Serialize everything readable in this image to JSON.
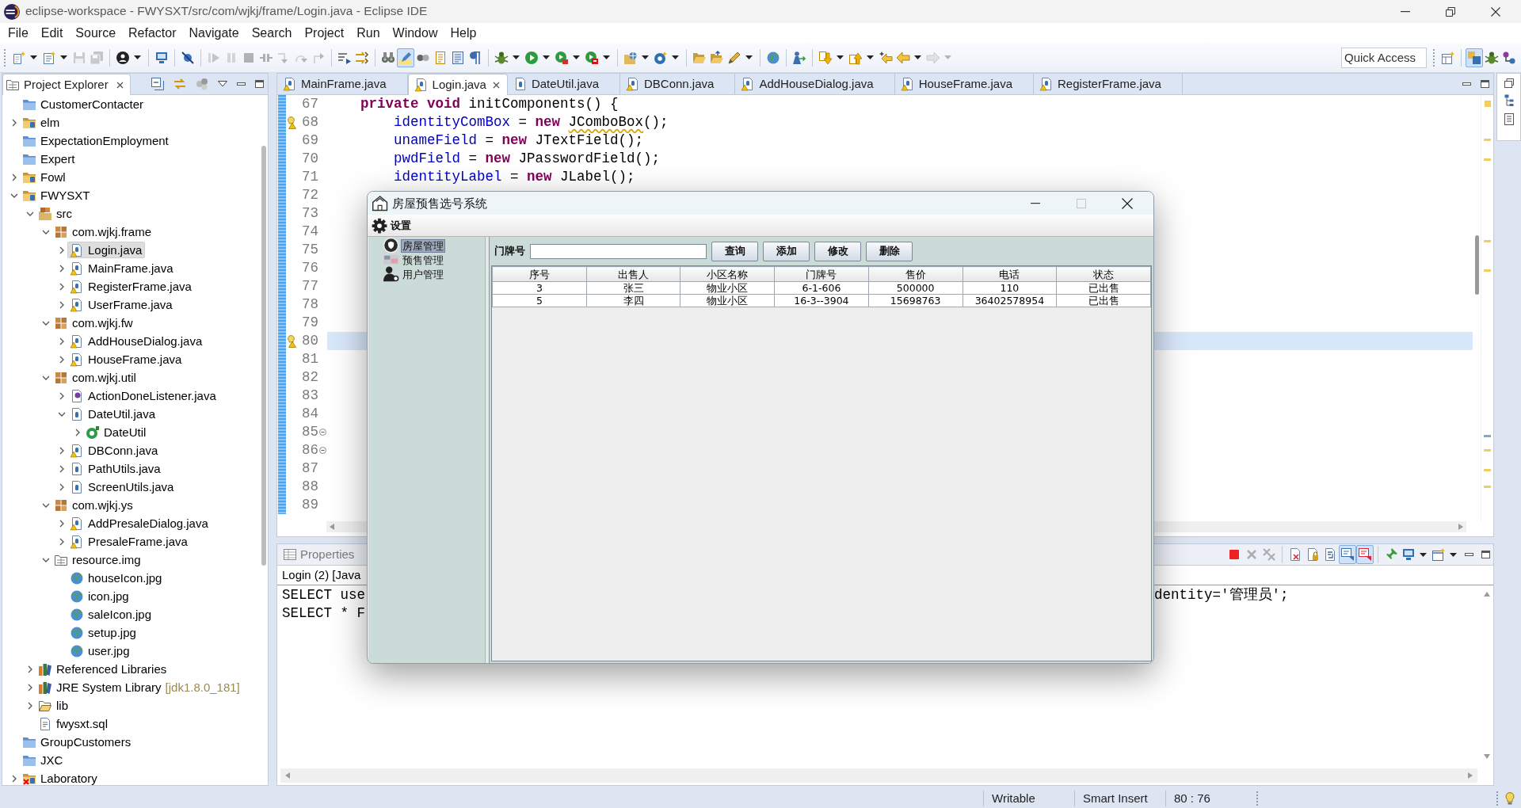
{
  "window": {
    "title": "eclipse-workspace - FWYSXT/src/com/wjkj/frame/Login.java - Eclipse IDE"
  },
  "menu": [
    "File",
    "Edit",
    "Source",
    "Refactor",
    "Navigate",
    "Search",
    "Project",
    "Run",
    "Window",
    "Help"
  ],
  "toolbar": {
    "groups": [
      [
        {
          "kind": "new",
          "dropdown": true,
          "disabled": false,
          "on": false
        },
        {
          "kind": "new-document",
          "dropdown": true,
          "disabled": false,
          "on": false
        },
        {
          "kind": "save",
          "disabled": true,
          "on": false
        },
        {
          "kind": "save-all",
          "disabled": true,
          "on": false
        }
      ],
      [
        {
          "kind": "person-circle",
          "dropdown": true,
          "disabled": false,
          "on": false
        }
      ],
      [
        {
          "kind": "monitor",
          "disabled": false,
          "on": false
        }
      ],
      [
        {
          "kind": "crossed-dot",
          "disabled": false,
          "on": false
        }
      ],
      [
        {
          "kind": "resume",
          "disabled": true,
          "on": false
        },
        {
          "kind": "pause",
          "disabled": true,
          "on": false
        },
        {
          "kind": "stop",
          "disabled": true,
          "on": false
        },
        {
          "kind": "disconnect",
          "disabled": true,
          "on": false
        },
        {
          "kind": "step-into",
          "disabled": true,
          "on": false
        },
        {
          "kind": "step-over",
          "disabled": true,
          "on": false
        },
        {
          "kind": "step-return",
          "disabled": true,
          "on": false
        }
      ],
      [
        {
          "kind": "lines-arrow",
          "disabled": false,
          "on": false
        },
        {
          "kind": "crossed-arrows",
          "disabled": false,
          "on": false
        }
      ],
      [
        {
          "kind": "binoculars",
          "disabled": false,
          "on": false
        },
        {
          "kind": "highlighter",
          "disabled": false,
          "on": true
        },
        {
          "kind": "two-dots",
          "disabled": false,
          "on": false
        },
        {
          "kind": "document-lines",
          "disabled": false,
          "on": false
        },
        {
          "kind": "text-block",
          "disabled": false,
          "on": false
        },
        {
          "kind": "pilcrow",
          "disabled": false,
          "on": false
        }
      ],
      [
        {
          "kind": "bug",
          "dropdown": true,
          "disabled": false,
          "on": false
        },
        {
          "kind": "run",
          "dropdown": true,
          "disabled": false,
          "on": false
        },
        {
          "kind": "run-coverage",
          "dropdown": true,
          "disabled": false,
          "on": false
        },
        {
          "kind": "run-toolbox",
          "dropdown": true,
          "disabled": false,
          "on": false
        }
      ],
      [
        {
          "kind": "new-project",
          "dropdown": true,
          "disabled": false,
          "on": false
        },
        {
          "kind": "new-class",
          "dropdown": true,
          "disabled": false,
          "on": false
        }
      ],
      [
        {
          "kind": "open-folder",
          "disabled": false,
          "on": false
        },
        {
          "kind": "open-folder-arrow",
          "disabled": false,
          "on": false
        },
        {
          "kind": "pencil",
          "dropdown": true,
          "disabled": false,
          "on": false
        }
      ],
      [
        {
          "kind": "globe",
          "disabled": false,
          "on": false
        }
      ],
      [
        {
          "kind": "person-arrow",
          "disabled": false,
          "on": false
        }
      ],
      [
        {
          "kind": "down-arrow",
          "dropdown": true,
          "disabled": false,
          "on": false
        },
        {
          "kind": "up-arrow",
          "dropdown": true,
          "disabled": false,
          "on": false
        },
        {
          "kind": "back-star",
          "disabled": false,
          "on": false
        },
        {
          "kind": "back",
          "dropdown": true,
          "disabled": false,
          "on": false
        },
        {
          "kind": "forward",
          "dropdown": true,
          "disabled": true,
          "on": false
        }
      ]
    ],
    "quick_access": {
      "placeholder": "Quick Access"
    },
    "perspectives": [
      {
        "kind": "open-perspective",
        "selected": false
      },
      {
        "kind": "perspective",
        "selected": true
      },
      {
        "kind": "bug",
        "selected": false
      },
      {
        "kind": "branch",
        "selected": false
      }
    ]
  },
  "explorer": {
    "title": "Project Explorer",
    "tree": [
      {
        "label": "CustomerContacter",
        "kind": "project-closed",
        "selected": false
      },
      {
        "label": "elm",
        "kind": "java-project",
        "expanded": false,
        "selected": false
      },
      {
        "label": "ExpectationEmployment",
        "kind": "project-closed",
        "selected": false
      },
      {
        "label": "Expert",
        "kind": "project-closed",
        "selected": false
      },
      {
        "label": "Fowl",
        "kind": "java-project",
        "expanded": false,
        "selected": false
      },
      {
        "label": "FWYSXT",
        "kind": "java-project",
        "expanded": true,
        "selected": false,
        "children": [
          {
            "label": "src",
            "kind": "source-folder",
            "expanded": true,
            "selected": false,
            "children": [
              {
                "label": "com.wjkj.frame",
                "kind": "package",
                "expanded": true,
                "selected": false,
                "children": [
                  {
                    "label": "Login.java",
                    "kind": "java-file-warning",
                    "expanded": false,
                    "selected": true
                  },
                  {
                    "label": "MainFrame.java",
                    "kind": "java-file-warning",
                    "expanded": false,
                    "selected": false
                  },
                  {
                    "label": "RegisterFrame.java",
                    "kind": "java-file-warning",
                    "expanded": false,
                    "selected": false
                  },
                  {
                    "label": "UserFrame.java",
                    "kind": "java-file-warning",
                    "expanded": false,
                    "selected": false
                  }
                ]
              },
              {
                "label": "com.wjkj.fw",
                "kind": "package",
                "expanded": true,
                "selected": false,
                "children": [
                  {
                    "label": "AddHouseDialog.java",
                    "kind": "java-file-warning",
                    "expanded": false,
                    "selected": false
                  },
                  {
                    "label": "HouseFrame.java",
                    "kind": "java-file-warning",
                    "expanded": false,
                    "selected": false
                  }
                ]
              },
              {
                "label": "com.wjkj.util",
                "kind": "package",
                "expanded": true,
                "selected": false,
                "children": [
                  {
                    "label": "ActionDoneListener.java",
                    "kind": "interface-file",
                    "expanded": false,
                    "selected": false
                  },
                  {
                    "label": "DateUtil.java",
                    "kind": "java-file",
                    "expanded": true,
                    "selected": false,
                    "children": [
                      {
                        "label": "DateUtil",
                        "kind": "class",
                        "expanded": false,
                        "selected": false
                      }
                    ]
                  },
                  {
                    "label": "DBConn.java",
                    "kind": "java-file-warning",
                    "expanded": false,
                    "selected": false
                  },
                  {
                    "label": "PathUtils.java",
                    "kind": "java-file",
                    "expanded": false,
                    "selected": false
                  },
                  {
                    "label": "ScreenUtils.java",
                    "kind": "java-file",
                    "expanded": false,
                    "selected": false
                  }
                ]
              },
              {
                "label": "com.wjkj.ys",
                "kind": "package",
                "expanded": true,
                "selected": false,
                "children": [
                  {
                    "label": "AddPresaleDialog.java",
                    "kind": "java-file-warning",
                    "expanded": false,
                    "selected": false
                  },
                  {
                    "label": "PresaleFrame.java",
                    "kind": "java-file-warning",
                    "expanded": false,
                    "selected": false
                  }
                ]
              },
              {
                "label": "resource.img",
                "kind": "folder-grid",
                "expanded": true,
                "selected": false,
                "children": [
                  {
                    "label": "houseIcon.jpg",
                    "kind": "image",
                    "selected": false
                  },
                  {
                    "label": "icon.jpg",
                    "kind": "image",
                    "selected": false
                  },
                  {
                    "label": "saleIcon.jpg",
                    "kind": "image",
                    "selected": false
                  },
                  {
                    "label": "setup.jpg",
                    "kind": "image",
                    "selected": false
                  },
                  {
                    "label": "user.jpg",
                    "kind": "image",
                    "selected": false
                  }
                ]
              }
            ]
          },
          {
            "label": "Referenced Libraries",
            "kind": "library",
            "expanded": false,
            "selected": false
          },
          {
            "label": "JRE System Library",
            "kind": "library",
            "expanded": false,
            "selected": false,
            "decoration": "[jdk1.8.0_181]"
          },
          {
            "label": "lib",
            "kind": "folder",
            "expanded": false,
            "selected": false
          },
          {
            "label": "fwysxt.sql",
            "kind": "text-file",
            "selected": false
          }
        ]
      },
      {
        "label": "GroupCustomers",
        "kind": "project-closed",
        "selected": false
      },
      {
        "label": "JXC",
        "kind": "project-closed",
        "selected": false
      },
      {
        "label": "Laboratory",
        "kind": "project-error",
        "expanded": false,
        "selected": false
      }
    ]
  },
  "editor": {
    "tabs": [
      {
        "label": "MainFrame.java",
        "kind": "java-file-warning",
        "selected": false
      },
      {
        "label": "Login.java",
        "kind": "java-file-warning",
        "selected": true
      },
      {
        "label": "DateUtil.java",
        "kind": "java-file",
        "selected": false
      },
      {
        "label": "DBConn.java",
        "kind": "java-file-warning",
        "selected": false
      },
      {
        "label": "AddHouseDialog.java",
        "kind": "java-file-warning",
        "selected": false
      },
      {
        "label": "HouseFrame.java",
        "kind": "java-file-warning",
        "selected": false
      },
      {
        "label": "RegisterFrame.java",
        "kind": "java-file-warning",
        "selected": false
      }
    ],
    "lines": [
      {
        "number": "67",
        "current": false,
        "warning": false,
        "tokens": [
          {
            "text": "    private void",
            "kind": "keyword"
          },
          {
            "text": " initComponents() {",
            "kind": "plain"
          }
        ]
      },
      {
        "number": "68",
        "current": false,
        "warning": true,
        "tokens": [
          {
            "text": "        identityComBox",
            "kind": "field"
          },
          {
            "text": " = ",
            "kind": "plain"
          },
          {
            "text": "new ",
            "kind": "keyword"
          },
          {
            "text": "JComboBox",
            "kind": "warned"
          },
          {
            "text": "();",
            "kind": "plain"
          }
        ]
      },
      {
        "number": "69",
        "current": false,
        "warning": false,
        "tokens": [
          {
            "text": "        unameField",
            "kind": "field"
          },
          {
            "text": " = ",
            "kind": "plain"
          },
          {
            "text": "new",
            "kind": "keyword"
          },
          {
            "text": " JTextField();",
            "kind": "plain"
          }
        ]
      },
      {
        "number": "70",
        "current": false,
        "warning": false,
        "tokens": [
          {
            "text": "        pwdField",
            "kind": "field"
          },
          {
            "text": " = ",
            "kind": "plain"
          },
          {
            "text": "new",
            "kind": "keyword"
          },
          {
            "text": " JPasswordField();",
            "kind": "plain"
          }
        ]
      },
      {
        "number": "71",
        "current": false,
        "warning": false,
        "tokens": [
          {
            "text": "        identityLabel",
            "kind": "field"
          },
          {
            "text": " = ",
            "kind": "plain"
          },
          {
            "text": "new",
            "kind": "keyword"
          },
          {
            "text": " JLabel();",
            "kind": "plain"
          }
        ]
      },
      {
        "number": "72",
        "current": false,
        "warning": false
      },
      {
        "number": "73",
        "current": false,
        "warning": false
      },
      {
        "number": "74",
        "current": false,
        "warning": false
      },
      {
        "number": "75",
        "current": false,
        "warning": false
      },
      {
        "number": "76",
        "current": false,
        "warning": false
      },
      {
        "number": "77",
        "current": false,
        "warning": false
      },
      {
        "number": "78",
        "current": false,
        "warning": false
      },
      {
        "number": "79",
        "current": false,
        "warning": false
      },
      {
        "number": "80",
        "current": true,
        "warning": true
      },
      {
        "number": "81",
        "current": false,
        "warning": false
      },
      {
        "number": "82",
        "current": false,
        "warning": false
      },
      {
        "number": "83",
        "current": false,
        "warning": false
      },
      {
        "number": "84",
        "current": false,
        "warning": false
      },
      {
        "number": "85",
        "current": false,
        "warning": false,
        "folded": false
      },
      {
        "number": "86",
        "current": false,
        "warning": false,
        "folded": false
      },
      {
        "number": "87",
        "current": false,
        "warning": false
      },
      {
        "number": "88",
        "current": false,
        "warning": false
      },
      {
        "number": "89",
        "current": false,
        "warning": false
      }
    ]
  },
  "console": {
    "tabs": [
      {
        "label": "Properties",
        "selected": false
      }
    ],
    "toolbar": [
      [
        {
          "kind": "stop",
          "disabled": false,
          "on": false
        },
        {
          "kind": "remove",
          "disabled": true,
          "on": false
        },
        {
          "kind": "remove-all",
          "disabled": true,
          "on": false
        }
      ],
      [
        {
          "kind": "clear",
          "disabled": false,
          "on": false
        },
        {
          "kind": "scroll-lock",
          "disabled": false,
          "on": false
        },
        {
          "kind": "wrap",
          "disabled": false,
          "on": false
        },
        {
          "kind": "stdout",
          "disabled": false,
          "on": true
        },
        {
          "kind": "stderr",
          "disabled": false,
          "on": true
        }
      ],
      [
        {
          "kind": "pin",
          "disabled": false,
          "on": false
        },
        {
          "kind": "monitor",
          "dropdown": true,
          "disabled": false,
          "on": false
        },
        {
          "kind": "new-console",
          "dropdown": true,
          "disabled": false,
          "on": false
        }
      ]
    ],
    "description": "Login (2) [Java",
    "lines": [
      {
        "start": "SELECT use",
        "end": "dentity='管理员';"
      },
      {
        "start": "SELECT * F"
      }
    ]
  },
  "status_bar": {
    "items": [
      "Writable",
      "Smart Insert",
      "80 : 76"
    ]
  },
  "dialog": {
    "title": "房屋预售选号系统",
    "window_buttons": [
      {
        "kind": "minimize",
        "disabled": false
      },
      {
        "kind": "maximize",
        "disabled": true
      },
      {
        "kind": "close",
        "disabled": false
      }
    ],
    "menu": [
      {
        "label": "设置",
        "kind": "gear"
      }
    ],
    "tree": [
      {
        "label": "房屋管理",
        "kind": "shield",
        "selected": true
      },
      {
        "label": "预售管理",
        "kind": "picture",
        "selected": false
      },
      {
        "label": "用户管理",
        "kind": "user-gear",
        "selected": false
      }
    ],
    "search": {
      "label": "门牌号"
    },
    "buttons": [
      "查询",
      "添加",
      "修改",
      "删除"
    ],
    "table": {
      "columns": [
        "序号",
        "出售人",
        "小区名称",
        "门牌号",
        "售价",
        "电话",
        "状态"
      ],
      "rows": [
        [
          "3",
          "张三",
          "物业小区",
          "6-1-606",
          "500000",
          "110",
          "已出售"
        ],
        [
          "5",
          "李四",
          "物业小区",
          "16-3--3904",
          "15698763",
          "36402578954",
          "已出售"
        ]
      ]
    }
  }
}
